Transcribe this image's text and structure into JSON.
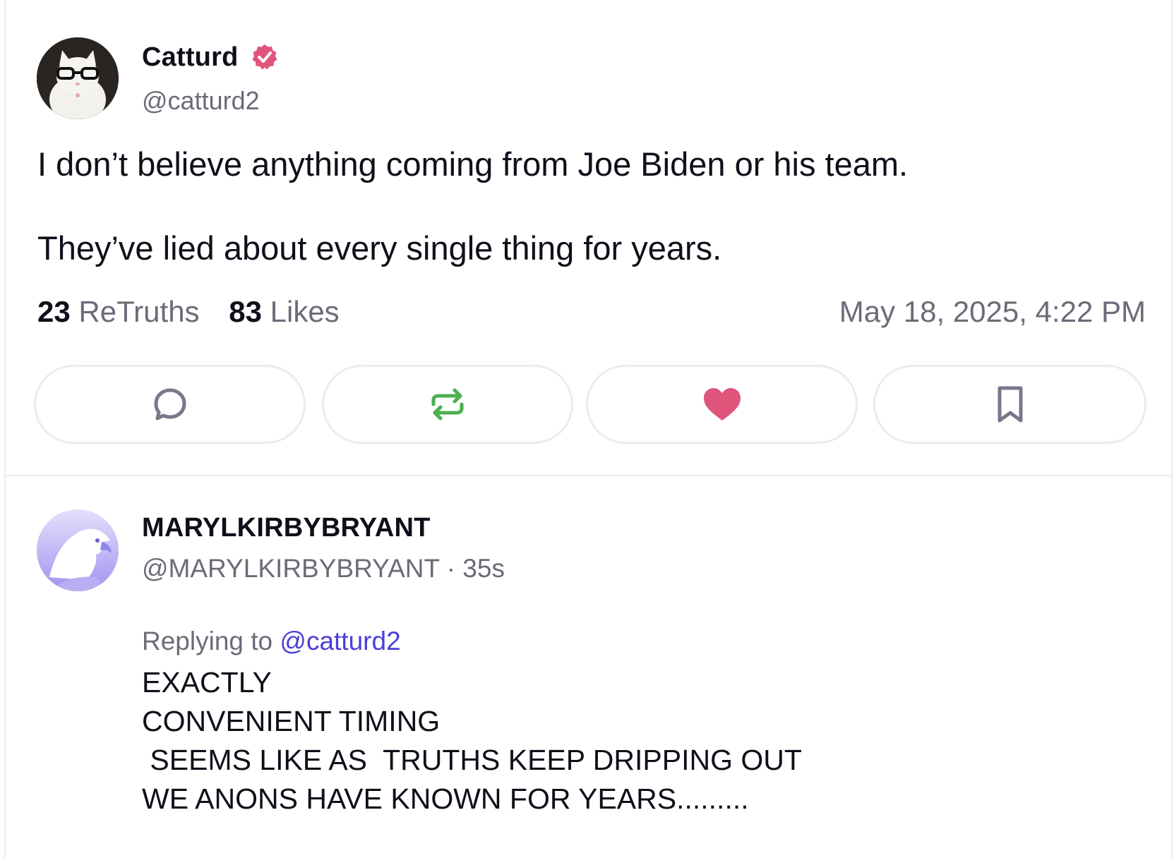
{
  "post": {
    "author_name": "Catturd",
    "author_handle": "@catturd2",
    "avatar_icon": "cat-with-glasses-avatar",
    "verified_icon": "verified-badge-icon",
    "text_line1": "I don’t believe anything coming from Joe Biden or his team.",
    "text_line2": "They’ve lied about every single thing for years.",
    "retruths_count": "23",
    "retruths_label": "ReTruths",
    "likes_count": "83",
    "likes_label": "Likes",
    "timestamp": "May 18, 2025, 4:22 PM"
  },
  "actions": {
    "reply_icon": "reply-icon",
    "retruth_icon": "retruth-icon",
    "like_icon": "heart-icon",
    "bookmark_icon": "bookmark-icon"
  },
  "reply": {
    "author_name": "MARYLKIRBYBRYANT",
    "author_handle": "@MARYLKIRBYBRYANT",
    "time_ago": "35s",
    "avatar_icon": "eagle-avatar",
    "replying_label": "Replying to",
    "replying_mention": "@catturd2",
    "body_line1": "EXACTLY",
    "body_line2": "CONVENIENT TIMING",
    "body_line3": " SEEMS LIKE AS  TRUTHS KEEP DRIPPING OUT",
    "body_line4": "WE ANONS HAVE KNOWN FOR YEARS........."
  },
  "colors": {
    "verified": "#e0557c",
    "heart": "#e0557c",
    "retruth": "#4caf50",
    "mention": "#4b3fd6",
    "muted_text": "#6b6b78"
  }
}
